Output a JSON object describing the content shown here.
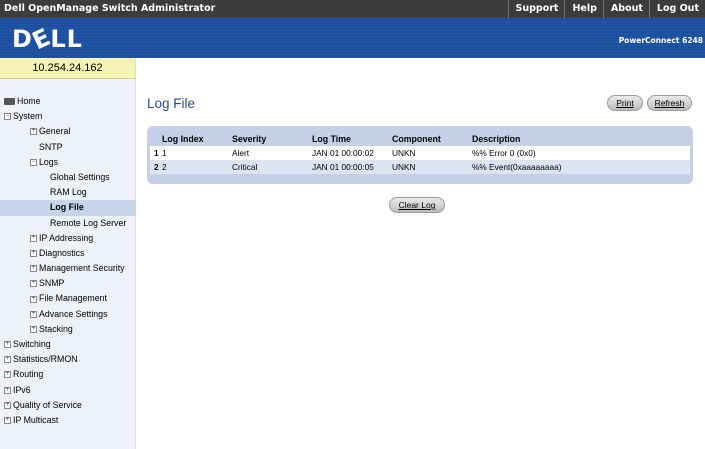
{
  "app_title": "Dell OpenManage Switch Administrator",
  "top_links": [
    "Support",
    "Help",
    "About",
    "Log Out"
  ],
  "banner": {
    "logo": "DELL",
    "model": "PowerConnect 6248"
  },
  "ip_address": "10.254.24.162",
  "tree": {
    "home": "Home",
    "system": "System",
    "general": "General",
    "sntp": "SNTP",
    "logs": "Logs",
    "global_settings": "Global Settings",
    "ram_log": "RAM Log",
    "log_file": "Log File",
    "remote_log_server": "Remote Log Server",
    "ip_addressing": "IP Addressing",
    "diagnostics": "Diagnostics",
    "management_security": "Management Security",
    "snmp": "SNMP",
    "file_management": "File Management",
    "advance_settings": "Advance Settings",
    "stacking": "Stacking",
    "switching": "Switching",
    "statistics_rmon": "Statistics/RMON",
    "routing": "Routing",
    "ipv6": "IPv6",
    "quality_of_service": "Quality of Service",
    "ip_multicast": "IP Multicast"
  },
  "main": {
    "page_title": "Log File",
    "print_label": "Print",
    "refresh_label": "Refresh",
    "clear_log_label": "Clear Log"
  },
  "log_table": {
    "headers": [
      "Log Index",
      "Severity",
      "Log Time",
      "Component",
      "Description"
    ],
    "rows": [
      {
        "num": "1",
        "index": "1",
        "severity": "Alert",
        "time": "JAN 01 00:00:02",
        "component": "UNKN",
        "description": "%% Error 0 (0x0)"
      },
      {
        "num": "2",
        "index": "2",
        "severity": "Critical",
        "time": "JAN 01 00:00:05",
        "component": "UNKN",
        "description": "%% Event(0xaaaaaaaa)"
      }
    ]
  }
}
